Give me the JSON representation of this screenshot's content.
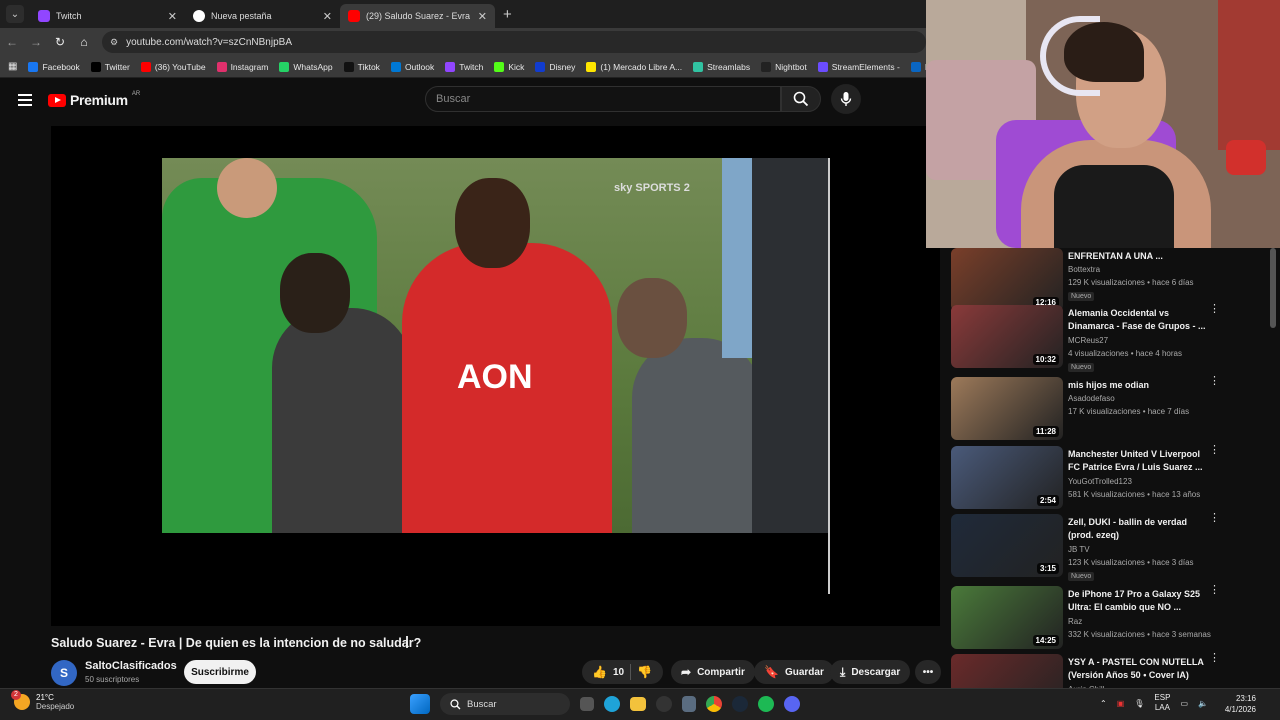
{
  "browser": {
    "tabs": [
      {
        "label": "Twitch",
        "color": "#9146ff",
        "active": false
      },
      {
        "label": "Nueva pestaña",
        "color": "#ffffff",
        "active": false
      },
      {
        "label": "(29) Saludo Suarez - Evra | De q",
        "color": "#ff0000",
        "active": true
      }
    ],
    "url": "youtube.com/watch?v=szCnNBnjpBA",
    "bookmarks": [
      {
        "label": "Facebook",
        "color": "#1877f2"
      },
      {
        "label": "Twitter",
        "color": "#000000"
      },
      {
        "label": "(36) YouTube",
        "color": "#ff0000"
      },
      {
        "label": "Instagram",
        "color": "#e1306c"
      },
      {
        "label": "WhatsApp",
        "color": "#25d366"
      },
      {
        "label": "Tiktok",
        "color": "#111111"
      },
      {
        "label": "Outlook",
        "color": "#0078d4"
      },
      {
        "label": "Twitch",
        "color": "#9146ff"
      },
      {
        "label": "Kick",
        "color": "#53fc18"
      },
      {
        "label": "Disney",
        "color": "#113ccf"
      },
      {
        "label": "(1) Mercado Libre A...",
        "color": "#ffe600"
      },
      {
        "label": "Streamlabs",
        "color": "#31c3a2"
      },
      {
        "label": "Nightbot",
        "color": "#222222"
      },
      {
        "label": "StreamElements -",
        "color": "#6b4cff"
      },
      {
        "label": "Linke",
        "color": "#0a66c2"
      }
    ]
  },
  "youtube": {
    "logo": "Premium",
    "logo_region": "AR",
    "search_placeholder": "Buscar"
  },
  "video": {
    "title": "Saludo Suarez - Evra | De quien es la intencion de no saludar?",
    "channel": "SaltoClasificados",
    "channel_initial": "S",
    "subscribers": "50 suscriptores",
    "subscribe_label": "Suscribirme",
    "likes": "10",
    "share_label": "Compartir",
    "save_label": "Guardar",
    "download_label": "Descargar",
    "overlay_logo": "sky SPORTS 2"
  },
  "recommendations": [
    {
      "title": "ENFRENTAN A UNA ...",
      "channel": "Bottextra",
      "meta": "129 K visualizaciones • hace 6 días",
      "duration": "12:16",
      "badge": "Nuevo",
      "thumb": "#7a3f2a"
    },
    {
      "title": "Alemania Occidental vs Dinamarca - Fase de Grupos - ...",
      "channel": "MCReus27",
      "meta": "4 visualizaciones • hace 4 horas",
      "duration": "10:32",
      "badge": "Nuevo",
      "thumb": "#8a3a3a"
    },
    {
      "title": "mis hijos me odian",
      "channel": "Asadodefaso",
      "meta": "17 K visualizaciones • hace 7 días",
      "duration": "11:28",
      "badge": "",
      "thumb": "#9d7a5a"
    },
    {
      "title": "Manchester United V Liverpool FC Patrice Evra / Luis Suarez ...",
      "channel": "YouGotTrolled123",
      "meta": "581 K visualizaciones • hace 13 años",
      "duration": "2:54",
      "badge": "",
      "thumb": "#4a5a7a"
    },
    {
      "title": "Zell, DUKI - ballin de verdad (prod. ezeq)",
      "channel": "JB TV",
      "meta": "123 K visualizaciones • hace 3 días",
      "duration": "3:15",
      "badge": "Nuevo",
      "thumb": "#1f2a3a"
    },
    {
      "title": "De iPhone 17 Pro a Galaxy S25 Ultra: El cambio que NO ...",
      "channel": "Raz",
      "meta": "332 K visualizaciones • hace 3 semanas",
      "duration": "14:25",
      "badge": "",
      "thumb": "#4a7a3a"
    },
    {
      "title": "YSY A - PASTEL CON NUTELLA (Versión Años 50 • Cover IA)",
      "channel": "Aurin Chill",
      "meta": "",
      "duration": "",
      "badge": "",
      "thumb": "#6a2a2a"
    }
  ],
  "taskbar": {
    "temperature": "21°C",
    "weather": "Despejado",
    "notif_count": "2",
    "search": "Buscar",
    "lang_1": "ESP",
    "lang_2": "LAA",
    "time": "23:16",
    "date": "4/1/2026"
  }
}
